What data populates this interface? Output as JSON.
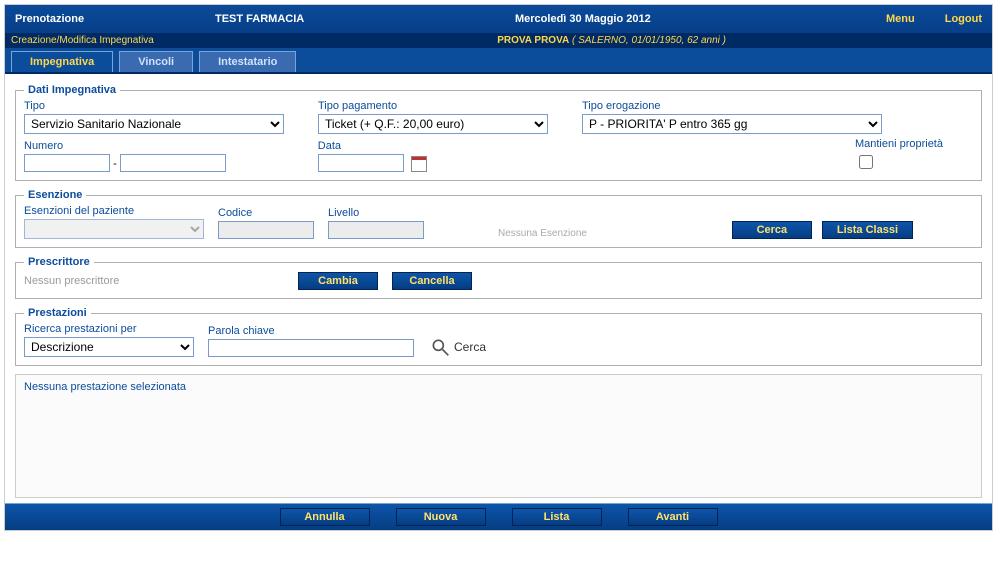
{
  "header": {
    "title": "Prenotazione",
    "pharmacy": "TEST FARMACIA",
    "date": "Mercoledì 30 Maggio 2012",
    "menu": "Menu",
    "logout": "Logout"
  },
  "breadcrumb": {
    "path": "Creazione/Modifica Impegnativa",
    "patient_name": "PROVA PROVA",
    "patient_detail": "( SALERNO, 01/01/1950, 62 anni )"
  },
  "tabs": {
    "impegnativa": "Impegnativa",
    "vincoli": "Vincoli",
    "intestatario": "Intestatario"
  },
  "dati": {
    "legend": "Dati Impegnativa",
    "tipo_label": "Tipo",
    "tipo_value": "Servizio Sanitario Nazionale",
    "pagamento_label": "Tipo pagamento",
    "pagamento_value": "Ticket (+ Q.F.: 20,00 euro)",
    "erogazione_label": "Tipo erogazione",
    "erogazione_value": "P - PRIORITA' P entro 365 gg",
    "numero_label": "Numero",
    "numero_a": "",
    "numero_b": "",
    "data_label": "Data",
    "data_value": "",
    "mantieni_label": "Mantieni proprietà"
  },
  "esenzione": {
    "legend": "Esenzione",
    "paziente_label": "Esenzioni del paziente",
    "codice_label": "Codice",
    "codice_value": "",
    "livello_label": "Livello",
    "livello_value": "",
    "nessuna": "Nessuna Esenzione",
    "cerca": "Cerca",
    "lista_classi": "Lista Classi"
  },
  "prescrittore": {
    "legend": "Prescrittore",
    "none": "Nessun prescrittore",
    "cambia": "Cambia",
    "cancella": "Cancella"
  },
  "prestazioni": {
    "legend": "Prestazioni",
    "ricerca_label": "Ricerca prestazioni per",
    "ricerca_value": "Descrizione",
    "parola_label": "Parola chiave",
    "parola_value": "",
    "cerca": "Cerca",
    "none": "Nessuna prestazione selezionata"
  },
  "bottom": {
    "annulla": "Annulla",
    "nuova": "Nuova",
    "lista": "Lista",
    "avanti": "Avanti"
  }
}
